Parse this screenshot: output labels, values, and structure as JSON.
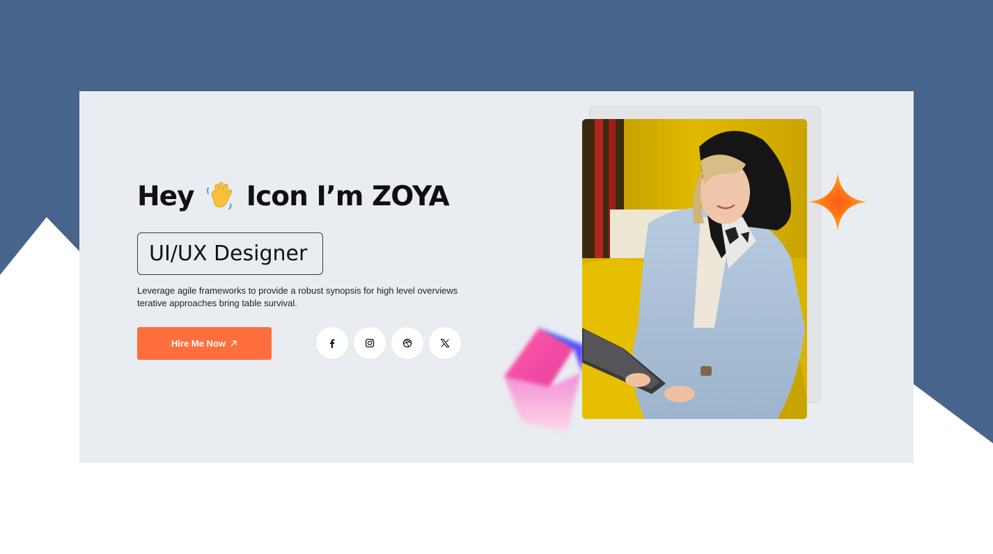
{
  "hero": {
    "greeting": "Hey",
    "name_line": "Icon I’m ZOYA",
    "role": "UI/UX Designer",
    "description": "Leverage agile frameworks to provide a robust synopsis for high level overviews terative approaches bring table survival.",
    "cta_label": "Hire Me Now",
    "cta_icon": "arrow-up-right-icon",
    "wave_icon": "waving-hand-icon"
  },
  "socials": [
    {
      "icon": "facebook-icon"
    },
    {
      "icon": "instagram-icon"
    },
    {
      "icon": "dribbble-icon"
    },
    {
      "icon": "x-icon"
    }
  ],
  "colors": {
    "background_blue": "#47648c",
    "card": "#e9ecf0",
    "accent": "#ff6f3e",
    "sparkle": "#ff7a12"
  }
}
